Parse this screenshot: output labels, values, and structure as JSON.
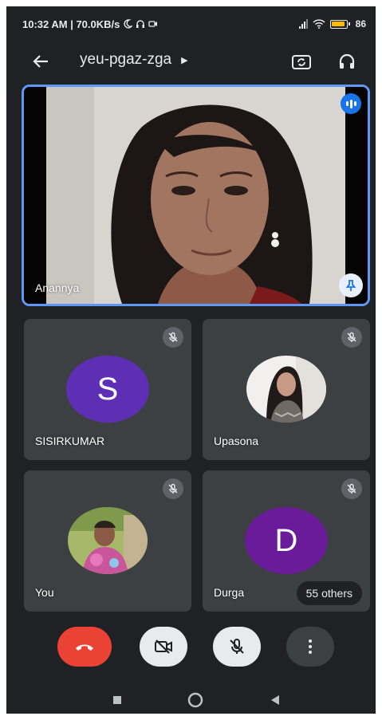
{
  "status_bar": {
    "time_speed": "10:32 AM | 70.0KB/s",
    "battery_text": "86"
  },
  "app_bar": {
    "meeting_code": "yeu-pgaz-zga",
    "icons": [
      "back-arrow-icon",
      "caret-right-icon",
      "switch-camera-icon",
      "headphones-icon"
    ]
  },
  "main_tile": {
    "name": "Anannya",
    "speaking": true,
    "pinned": true,
    "colors": {
      "border": "#5e97f6",
      "speaking_badge": "#1a73e8"
    }
  },
  "participants": [
    {
      "name": "SISIRKUMAR",
      "avatar_letter": "S",
      "avatar_color": "#5e2fb5",
      "muted": true
    },
    {
      "name": "Upasona",
      "avatar_letter": "",
      "avatar_color": "",
      "muted": true
    },
    {
      "name": "You",
      "avatar_letter": "",
      "avatar_color": "",
      "muted": true
    },
    {
      "name": "Durga",
      "avatar_letter": "D",
      "avatar_color": "#6a1b9a",
      "muted": true
    }
  ],
  "others_count_label": "55 others",
  "controls": {
    "icons": [
      "end-call-icon",
      "camera-off-icon",
      "mic-off-icon",
      "more-vert-icon"
    ],
    "colors": {
      "end": "#ea4335",
      "toggle_bg": "#e8eaed",
      "more_bg": "#3c4043"
    }
  },
  "nav_bar": {
    "icons": [
      "recents-square-icon",
      "home-circle-icon",
      "back-triangle-icon"
    ]
  }
}
